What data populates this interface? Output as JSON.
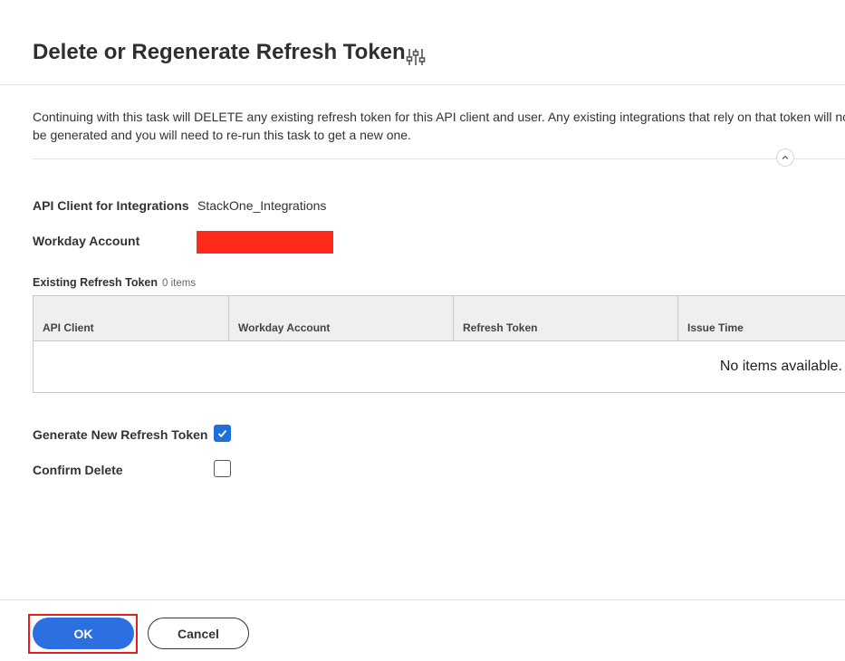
{
  "header": {
    "title": "Delete or Regenerate Refresh Token",
    "settings_icon": "settings-sliders-icon"
  },
  "intro": {
    "line1": "Continuing with this task will DELETE any existing refresh token for this API client and user. Any existing integrations that rely on that token will no",
    "line2": "be generated and you will need to re-run this task to get a new one."
  },
  "fields": {
    "api_client_label": "API Client for Integrations",
    "api_client_value": "StackOne_Integrations",
    "workday_account_label": "Workday Account",
    "workday_account_redacted_color": "#ff2a1a"
  },
  "existing_tokens": {
    "label": "Existing Refresh Token",
    "count": "0 items",
    "columns": [
      "API Client",
      "Workday Account",
      "Refresh Token",
      "Issue Time"
    ],
    "empty_message": "No items available."
  },
  "options": {
    "generate_label": "Generate New Refresh Token",
    "generate_checked": true,
    "confirm_label": "Confirm Delete",
    "confirm_checked": false
  },
  "footer": {
    "ok_label": "OK",
    "cancel_label": "Cancel"
  },
  "colors": {
    "primary": "#2b6fe0",
    "highlight_outline": "#e02020"
  }
}
